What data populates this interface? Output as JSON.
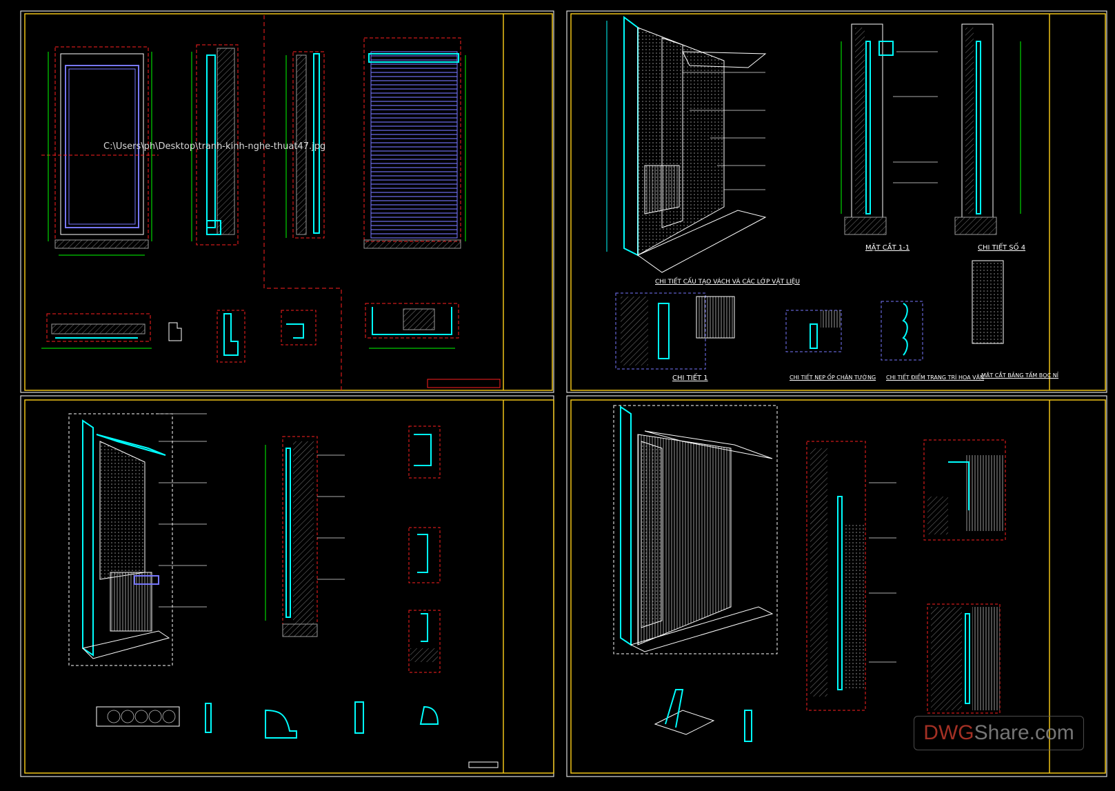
{
  "file_path": "C:\\Users\\ph\\Desktop\\tranh-kinh-nghe-thuat47.jpg",
  "watermark": {
    "part1": "DWG",
    "part2": "Share.com"
  },
  "sheets": {
    "top_right": {
      "labels": {
        "wall_structure_detail": "CHI TIẾT CẤU TẠO VÁCH VÀ CÁC LỚP VẬT LIỆU",
        "section_1_1": "MẶT CẮT 1-1",
        "detail_4": "CHI TIẾT SỐ 4",
        "detail_1": "CHI TIẾT 1",
        "baseboard_detail": "CHI TIẾT NẸP ỐP CHÂN TƯỜNG",
        "decor_detail": "CHI TIẾT ĐIỂM TRANG TRÍ HOA VĂN",
        "panel_section": "MẶT CẮT BẢNG TẤM BỌC NỈ"
      }
    }
  },
  "colors": {
    "frame": "#f0c419",
    "sheet_border": "#dddddd",
    "cyan": "#00ffff",
    "red_dash": "#ff2020",
    "green": "#00ff00",
    "white": "#ffffff",
    "blue": "#7878ff",
    "gray": "#9a9a9a"
  }
}
